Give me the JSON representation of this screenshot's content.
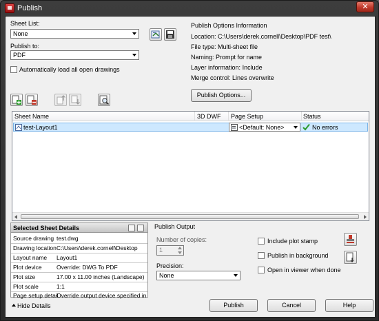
{
  "window": {
    "title": "Publish",
    "close_label": "✕"
  },
  "sheet_list": {
    "label": "Sheet List:",
    "value": "None"
  },
  "publish_to": {
    "label": "Publish to:",
    "value": "PDF"
  },
  "auto_load": {
    "label": "Automatically load all open drawings",
    "checked": false
  },
  "options_info": {
    "title": "Publish Options Information",
    "location_label": "Location:",
    "location_value": "C:\\Users\\derek.cornell\\Desktop\\PDF test\\",
    "filetype_label": "File type:",
    "filetype_value": "Multi-sheet file",
    "naming_label": "Naming:",
    "naming_value": "Prompt for name",
    "layer_label": "Layer information:",
    "layer_value": "Include",
    "merge_label": "Merge control:",
    "merge_value": "Lines overwrite",
    "button_label": "Publish Options..."
  },
  "table": {
    "headers": [
      "Sheet Name",
      "3D DWF",
      "Page Setup",
      "Status"
    ],
    "rows": [
      {
        "sheet_name": "test-Layout1",
        "dwf": "",
        "page_setup": "<Default: None>",
        "status": "No errors"
      }
    ]
  },
  "details": {
    "title": "Selected Sheet Details",
    "rows": [
      {
        "label": "Source drawing",
        "value": "test.dwg"
      },
      {
        "label": "Drawing location",
        "value": "C:\\Users\\derek.cornell\\Desktop"
      },
      {
        "label": "Layout name",
        "value": "Layout1"
      },
      {
        "label": "Plot device",
        "value": "Override: DWG To PDF"
      },
      {
        "label": "Plot size",
        "value": "17.00 x 11.00 inches (Landscape)"
      },
      {
        "label": "Plot scale",
        "value": "1:1"
      },
      {
        "label": "Page setup detail",
        "value": "Override output device specified in ..."
      }
    ]
  },
  "output": {
    "title": "Publish Output",
    "copies_label": "Number of copies:",
    "copies_value": "1",
    "precision_label": "Precision:",
    "precision_value": "None",
    "plot_stamp": {
      "label": "Include plot stamp",
      "checked": false
    },
    "background": {
      "label": "Publish in background",
      "checked": false
    },
    "open_viewer": {
      "label": "Open in viewer when done",
      "checked": false
    }
  },
  "footer": {
    "hide_details": "Hide Details",
    "publish": "Publish",
    "cancel": "Cancel",
    "help": "Help"
  },
  "colors": {
    "status_ok": "#2a9a2a",
    "selection": "#cde8ff"
  }
}
